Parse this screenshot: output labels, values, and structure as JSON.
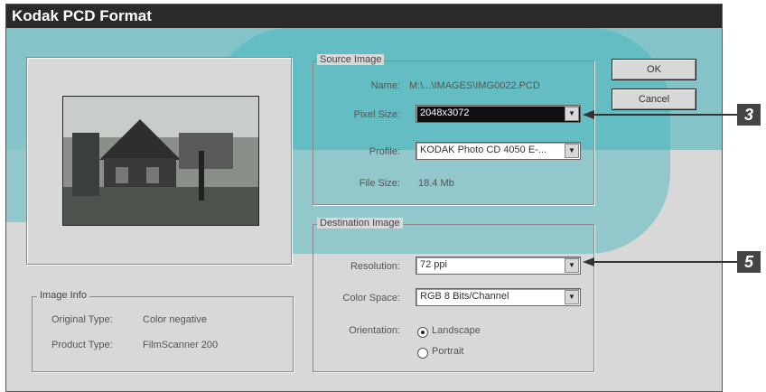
{
  "window": {
    "title": "Kodak PCD Format"
  },
  "source_image": {
    "group_label": "Source Image",
    "name_label": "Name:",
    "name_value": "M:\\...\\IMAGES\\IMG0022.PCD",
    "pixel_size_label": "Pixel Size:",
    "pixel_size_value": "2048x3072",
    "profile_label": "Profile:",
    "profile_value": "KODAK Photo CD 4050 E-...",
    "file_size_label": "File Size:",
    "file_size_value": "18.4 Mb"
  },
  "destination_image": {
    "group_label": "Destination Image",
    "resolution_label": "Resolution:",
    "resolution_value": "72 ppi",
    "color_space_label": "Color Space:",
    "color_space_value": "RGB 8 Bits/Channel",
    "orientation_label": "Orientation:",
    "orientation_options": [
      "Landscape",
      "Portrait"
    ],
    "orientation_selected": "Landscape"
  },
  "image_info": {
    "group_label": "Image Info",
    "original_type_label": "Original Type:",
    "original_type_value": "Color negative",
    "product_type_label": "Product Type:",
    "product_type_value": "FilmScanner 200"
  },
  "buttons": {
    "ok": "OK",
    "cancel": "Cancel"
  },
  "callouts": [
    "3",
    "5"
  ],
  "colors": {
    "teal": "#3fb5bd",
    "titlebar": "#2a2a2a",
    "dialog": "#d8d8d8"
  },
  "icons": {
    "dropdown": "chevron-down-icon"
  }
}
